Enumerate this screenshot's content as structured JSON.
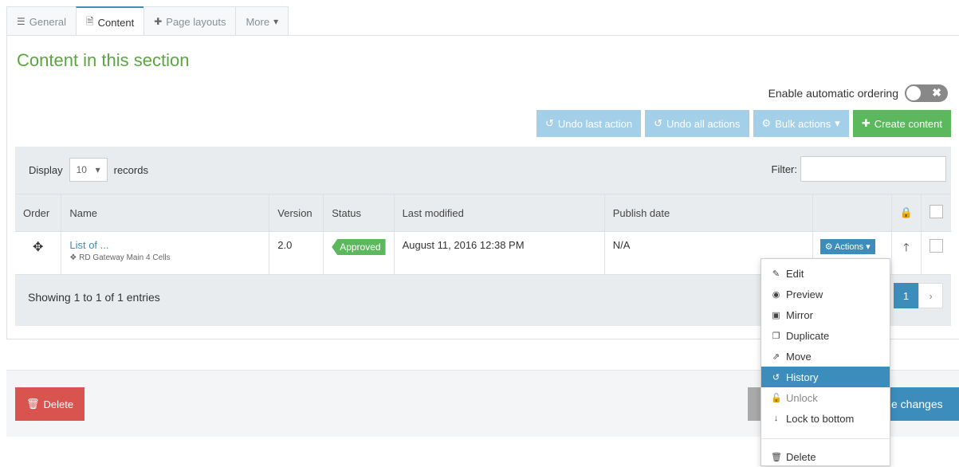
{
  "tabs": [
    {
      "label": "General",
      "icon": "sliders-icon"
    },
    {
      "label": "Content",
      "icon": "file-icon"
    },
    {
      "label": "Page layouts",
      "icon": "puzzle-icon"
    },
    {
      "label": "More",
      "icon": "caret-down-icon"
    }
  ],
  "section_title": "Content in this section",
  "auto_ordering": {
    "label": "Enable automatic ordering",
    "enabled": false
  },
  "toolbar": {
    "undo_last": "Undo last action",
    "undo_all": "Undo all actions",
    "bulk": "Bulk actions",
    "create": "Create content"
  },
  "display": {
    "prefix": "Display",
    "value": "10",
    "suffix": "records"
  },
  "filter": {
    "label": "Filter:",
    "value": ""
  },
  "columns": [
    "Order",
    "Name",
    "Version",
    "Status",
    "Last modified",
    "Publish date"
  ],
  "rows": [
    {
      "name": "List of ...",
      "sub": "RD Gateway Main 4 Cells",
      "version": "2.0",
      "status": "Approved",
      "last_modified": "August 11, 2016 12:38 PM",
      "publish_date": "N/A",
      "actions": "Actions"
    }
  ],
  "showing": "Showing 1 to 1 of 1 entries",
  "pager": {
    "current": "1",
    "next": "›"
  },
  "footer": {
    "delete": "Delete",
    "save": "e changes"
  },
  "menu": {
    "items": [
      {
        "label": "Edit",
        "icon": "edit-icon",
        "glyph": "✎"
      },
      {
        "label": "Preview",
        "icon": "eye-icon",
        "glyph": "◉"
      },
      {
        "label": "Mirror",
        "icon": "mirror-icon",
        "glyph": "▣"
      },
      {
        "label": "Duplicate",
        "icon": "copy-icon",
        "glyph": "❐"
      },
      {
        "label": "Move",
        "icon": "external-link-icon",
        "glyph": "⇗"
      },
      {
        "label": "History",
        "icon": "history-icon",
        "glyph": "↺"
      },
      {
        "label": "Unlock",
        "icon": "unlock-icon",
        "glyph": "🔓"
      },
      {
        "label": "Lock to bottom",
        "icon": "arrow-down-icon",
        "glyph": "↓"
      }
    ],
    "delete": {
      "label": "Delete",
      "icon": "trash-icon",
      "glyph": "🗑"
    }
  },
  "colors": {
    "accent": "#3c8dbc",
    "success": "#5cb85c",
    "danger": "#d9534f",
    "title": "#5aa641"
  }
}
